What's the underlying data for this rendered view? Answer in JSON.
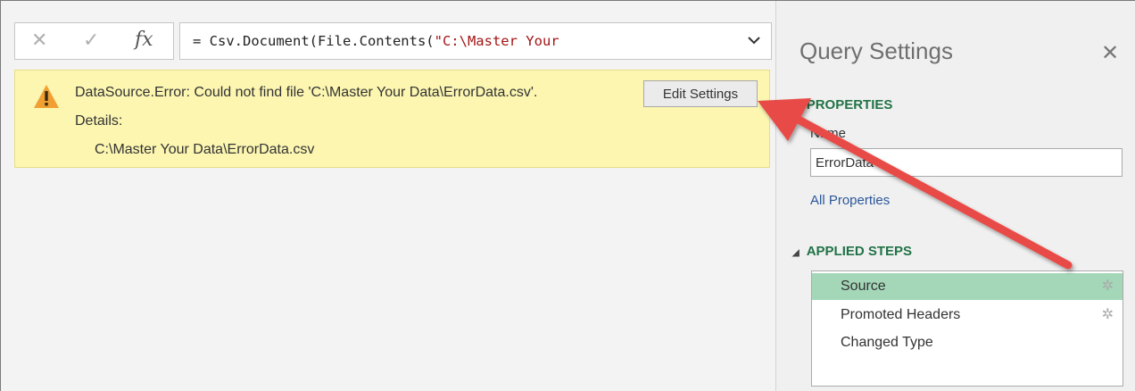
{
  "formula_bar": {
    "cancel_icon": "cancel-x-icon",
    "commit_icon": "checkmark-icon",
    "fx_label": "fx",
    "formula_prefix": "= Csv.Document(File.Contents(",
    "formula_string": "\"C:\\Master Your",
    "expand_icon": "chevron-down-icon"
  },
  "error": {
    "icon": "warning-triangle-icon",
    "message": "DataSource.Error: Could not find file 'C:\\Master Your Data\\ErrorData.csv'.",
    "details_label": "Details:",
    "details_value": "C:\\Master Your Data\\ErrorData.csv",
    "edit_button": "Edit Settings"
  },
  "query_settings": {
    "title": "Query Settings",
    "close_icon": "close-icon",
    "properties_header": "PROPERTIES",
    "name_label": "Name",
    "name_value": "ErrorData",
    "all_properties_link": "All Properties",
    "applied_steps_header": "APPLIED STEPS",
    "steps": [
      {
        "label": "Source",
        "selected": true,
        "has_gear": true
      },
      {
        "label": "Promoted Headers",
        "selected": false,
        "has_gear": true
      },
      {
        "label": "Changed Type",
        "selected": false,
        "has_gear": false
      }
    ]
  },
  "colors": {
    "accent_green": "#217346",
    "selected_step": "#a3d7b8",
    "error_banner": "#fcf6b1",
    "annotation_arrow": "#e84b46"
  }
}
